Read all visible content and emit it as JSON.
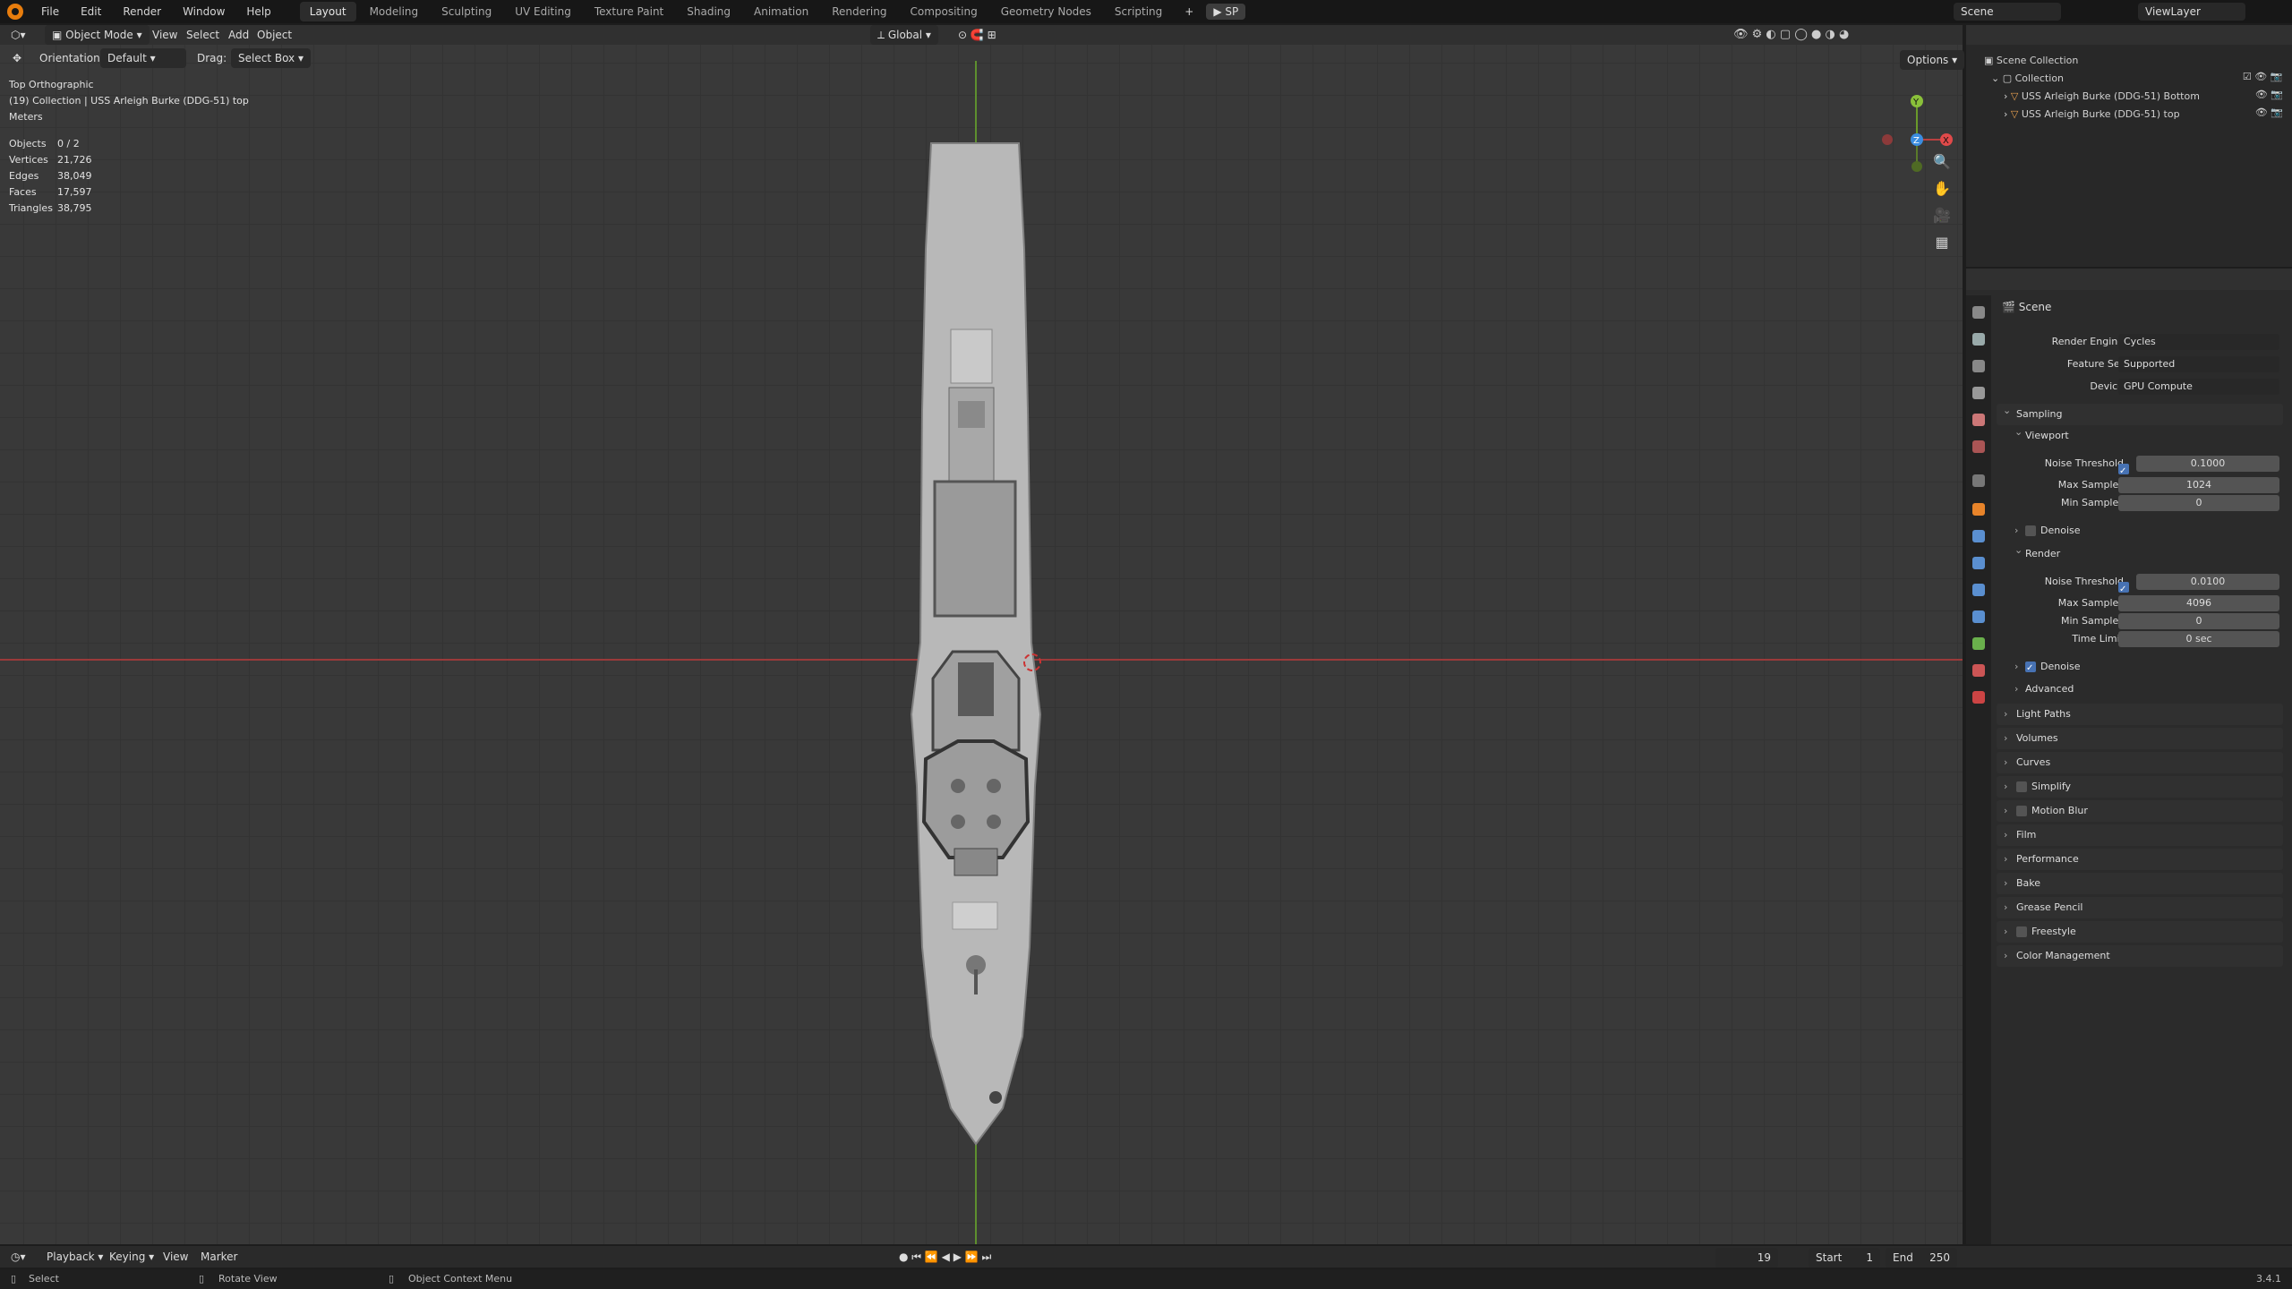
{
  "menu": {
    "items": [
      "File",
      "Edit",
      "Render",
      "Window",
      "Help"
    ]
  },
  "workspaces": {
    "tabs": [
      "Layout",
      "Modeling",
      "Sculpting",
      "UV Editing",
      "Texture Paint",
      "Shading",
      "Animation",
      "Rendering",
      "Compositing",
      "Geometry Nodes",
      "Scripting"
    ],
    "active": "Layout",
    "add": "+"
  },
  "topright": {
    "sp": "SP",
    "scene": "Scene",
    "viewlayer": "ViewLayer"
  },
  "viewheader": {
    "mode": "Object Mode",
    "view": "View",
    "select": "Select",
    "add": "Add",
    "object": "Object",
    "orientation_label": "Orientation:",
    "orientation": "Default",
    "drag_label": "Drag:",
    "drag": "Select Box",
    "transform": "Global",
    "options": "Options"
  },
  "overlay": {
    "view_name": "Top Orthographic",
    "collection": "(19) Collection | USS Arleigh Burke (DDG-51) top",
    "units": "Meters",
    "stats": [
      {
        "label": "Objects",
        "value": "0 / 2"
      },
      {
        "label": "Vertices",
        "value": "21,726"
      },
      {
        "label": "Edges",
        "value": "38,049"
      },
      {
        "label": "Faces",
        "value": "17,597"
      },
      {
        "label": "Triangles",
        "value": "38,795"
      }
    ]
  },
  "gizmo": {
    "y": "Y",
    "z": "Z",
    "x": "X"
  },
  "outliner": {
    "root": "Scene Collection",
    "collection": "Collection",
    "objects": [
      "USS Arleigh Burke (DDG-51) Bottom",
      "USS Arleigh Burke (DDG-51) top"
    ]
  },
  "properties": {
    "context": "Scene",
    "render_engine_label": "Render Engine",
    "render_engine": "Cycles",
    "feature_set_label": "Feature Set",
    "feature_set": "Supported",
    "device_label": "Device",
    "device": "GPU Compute",
    "sampling": "Sampling",
    "viewport": "Viewport",
    "noise_threshold_label": "Noise Threshold",
    "vp_noise": "0.1000",
    "max_samples_label": "Max Samples",
    "vp_max": "1024",
    "min_samples_label": "Min Samples",
    "vp_min": "0",
    "denoise": "Denoise",
    "render": "Render",
    "r_noise": "0.0100",
    "r_max": "4096",
    "r_min": "0",
    "time_limit_label": "Time Limit",
    "r_time": "0 sec",
    "r_denoise": "Denoise",
    "advanced": "Advanced",
    "panels": [
      "Light Paths",
      "Volumes",
      "Curves",
      "Simplify",
      "Motion Blur",
      "Film",
      "Performance",
      "Bake",
      "Grease Pencil",
      "Freestyle",
      "Color Management"
    ]
  },
  "timeline": {
    "playback": "Playback",
    "keying": "Keying",
    "view": "View",
    "marker": "Marker",
    "frame": "19",
    "start_label": "Start",
    "start": "1",
    "end_label": "End",
    "end": "250"
  },
  "status": {
    "select": "Select",
    "rotate": "Rotate View",
    "context": "Object Context Menu",
    "version": "3.4.1"
  }
}
